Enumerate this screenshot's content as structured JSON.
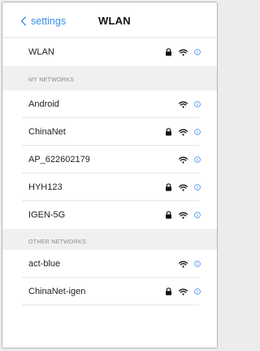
{
  "header": {
    "back_label": "settings",
    "title": "WLAN"
  },
  "wlan_toggle": {
    "label": "WLAN"
  },
  "my_networks": {
    "section_label": "MY NETWORKS",
    "items": [
      {
        "name": "Android",
        "locked": false
      },
      {
        "name": "ChinaNet",
        "locked": true
      },
      {
        "name": "AP_622602179",
        "locked": false
      },
      {
        "name": "HYH123",
        "locked": true
      },
      {
        "name": "IGEN-5G",
        "locked": true
      }
    ]
  },
  "other_networks": {
    "section_label": "OTHER NETWORKS",
    "items": [
      {
        "name": "act-blue",
        "locked": false
      },
      {
        "name": "ChinaNet-igen",
        "locked": true
      }
    ]
  },
  "colors": {
    "accent": "#3b8eea",
    "background": "#f0f0f0",
    "surface": "#ffffff",
    "icon": "#111111"
  },
  "icons": {
    "back": "chevron-left-icon",
    "lock": "lock-icon",
    "wifi": "wifi-icon",
    "info": "info-icon"
  }
}
